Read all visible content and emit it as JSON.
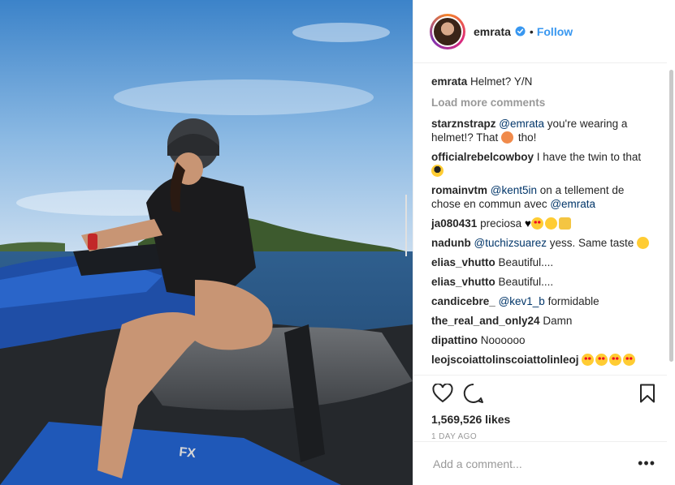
{
  "post": {
    "image_alt": "",
    "header": {
      "username": "emrata",
      "separator": "•",
      "follow_label": "Follow"
    },
    "caption": {
      "username": "emrata",
      "text": "Helmet? Y/N"
    },
    "load_more_label": "Load more comments",
    "comments": [
      {
        "username": "starznstrapz",
        "mention": "@emrata",
        "text": " you're wearing a helmet!? That ",
        "emojis": [
          "peach"
        ],
        "tail": " tho!"
      },
      {
        "username": "officialrebelcowboy",
        "text": "I have the twin to that",
        "emojis": [
          "sunglasses-face"
        ]
      },
      {
        "username": "romainvtm",
        "mention": "@kent5in",
        "text": " on a tellement de chose en commun avec ",
        "mention2": "@emrata"
      },
      {
        "username": "ja080431",
        "text": "preciosa",
        "emojis": [
          "heart",
          "heart-eyes",
          "kiss-face",
          "thumbs-up"
        ]
      },
      {
        "username": "nadunb",
        "mention": "@tuchizsuarez",
        "text": " yess. Same taste ",
        "emojis": [
          "kiss-face"
        ]
      },
      {
        "username": "elias_vhutto",
        "text": "Beautiful...."
      },
      {
        "username": "elias_vhutto",
        "text": "Beautiful...."
      },
      {
        "username": "candicebre_",
        "mention": "@kev1_b",
        "text": " formidable"
      },
      {
        "username": "the_real_and_only24",
        "text": "Damn"
      },
      {
        "username": "dipattino",
        "text": "Noooooo"
      },
      {
        "username": "leojscoiattolinscoiattolinleoj",
        "text": "",
        "emojis": [
          "heart-eyes",
          "heart-eyes",
          "heart-eyes",
          "heart-eyes"
        ]
      }
    ],
    "likes": "1,569,526 likes",
    "timestamp": "1 DAY AGO",
    "add_comment_placeholder": "Add a comment...",
    "more_label": "•••",
    "icons": {
      "like": "heart-outline-icon",
      "comment": "comment-bubble-icon",
      "save": "bookmark-icon",
      "verified": "verified-badge-icon"
    },
    "colors": {
      "link": "#3897f0",
      "verified": "#3897f0",
      "muted": "#999999",
      "text": "#262626"
    }
  }
}
